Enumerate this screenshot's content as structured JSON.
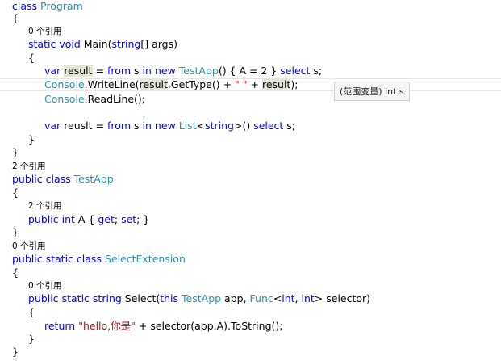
{
  "editor": {
    "lines": [
      {
        "kind": "code",
        "indent": 0,
        "tokens": [
          {
            "t": "class",
            "c": "kw"
          },
          {
            "t": " ",
            "c": "plain"
          },
          {
            "t": "Program",
            "c": "type"
          }
        ]
      },
      {
        "kind": "code",
        "indent": 0,
        "tokens": [
          {
            "t": "{",
            "c": "plain"
          }
        ]
      },
      {
        "kind": "codelens",
        "indent": 1,
        "tokens": [
          {
            "t": "0 个引用",
            "c": "plain"
          }
        ]
      },
      {
        "kind": "code",
        "indent": 1,
        "tokens": [
          {
            "t": "static",
            "c": "kw"
          },
          {
            "t": " ",
            "c": "plain"
          },
          {
            "t": "void",
            "c": "kw"
          },
          {
            "t": " Main(",
            "c": "plain"
          },
          {
            "t": "string",
            "c": "kw"
          },
          {
            "t": "[] args)",
            "c": "plain"
          }
        ]
      },
      {
        "kind": "code",
        "indent": 1,
        "tokens": [
          {
            "t": "{",
            "c": "plain"
          }
        ]
      },
      {
        "kind": "code",
        "indent": 2,
        "tokens": [
          {
            "t": "var",
            "c": "kw"
          },
          {
            "t": " ",
            "c": "plain"
          },
          {
            "t": "result",
            "c": "hl"
          },
          {
            "t": " = ",
            "c": "plain"
          },
          {
            "t": "from",
            "c": "kw"
          },
          {
            "t": " s ",
            "c": "plain"
          },
          {
            "t": "in",
            "c": "kw"
          },
          {
            "t": " ",
            "c": "plain"
          },
          {
            "t": "new",
            "c": "kw"
          },
          {
            "t": " ",
            "c": "plain"
          },
          {
            "t": "TestApp",
            "c": "type"
          },
          {
            "t": "() { A = 2 } ",
            "c": "plain"
          },
          {
            "t": "select",
            "c": "kw"
          },
          {
            "t": " s;",
            "c": "plain"
          }
        ]
      },
      {
        "kind": "code",
        "indent": 2,
        "tokens": [
          {
            "t": "Console",
            "c": "type"
          },
          {
            "t": ".WriteLine(",
            "c": "plain"
          },
          {
            "t": "result",
            "c": "hl"
          },
          {
            "t": ".GetType() + ",
            "c": "plain"
          },
          {
            "t": "\" \"",
            "c": "str"
          },
          {
            "t": " + ",
            "c": "plain"
          },
          {
            "t": "result",
            "c": "hl"
          },
          {
            "t": ");",
            "c": "plain"
          }
        ]
      },
      {
        "kind": "code",
        "indent": 2,
        "tokens": [
          {
            "t": "Console",
            "c": "type"
          },
          {
            "t": ".ReadLine();",
            "c": "plain"
          }
        ]
      },
      {
        "kind": "blank",
        "indent": 0,
        "tokens": []
      },
      {
        "kind": "code",
        "indent": 2,
        "tokens": [
          {
            "t": "var",
            "c": "kw"
          },
          {
            "t": " reuslt = ",
            "c": "plain"
          },
          {
            "t": "from",
            "c": "kw"
          },
          {
            "t": " s ",
            "c": "plain"
          },
          {
            "t": "in",
            "c": "kw"
          },
          {
            "t": " ",
            "c": "plain"
          },
          {
            "t": "new",
            "c": "kw"
          },
          {
            "t": " ",
            "c": "plain"
          },
          {
            "t": "List",
            "c": "type"
          },
          {
            "t": "<",
            "c": "plain"
          },
          {
            "t": "string",
            "c": "kw"
          },
          {
            "t": ">() ",
            "c": "plain"
          },
          {
            "t": "select",
            "c": "kw"
          },
          {
            "t": " s;",
            "c": "plain"
          }
        ]
      },
      {
        "kind": "code",
        "indent": 1,
        "tokens": [
          {
            "t": "}",
            "c": "plain"
          }
        ]
      },
      {
        "kind": "code",
        "indent": 0,
        "tokens": [
          {
            "t": "}",
            "c": "plain"
          }
        ]
      },
      {
        "kind": "codelens",
        "indent": 0,
        "tokens": [
          {
            "t": "2 个引用",
            "c": "plain"
          }
        ]
      },
      {
        "kind": "code",
        "indent": 0,
        "tokens": [
          {
            "t": "public",
            "c": "kw"
          },
          {
            "t": " ",
            "c": "plain"
          },
          {
            "t": "class",
            "c": "kw"
          },
          {
            "t": " ",
            "c": "plain"
          },
          {
            "t": "TestApp",
            "c": "type"
          }
        ]
      },
      {
        "kind": "code",
        "indent": 0,
        "tokens": [
          {
            "t": "{",
            "c": "plain"
          }
        ]
      },
      {
        "kind": "codelens",
        "indent": 1,
        "tokens": [
          {
            "t": "2 个引用",
            "c": "plain"
          }
        ]
      },
      {
        "kind": "code",
        "indent": 1,
        "tokens": [
          {
            "t": "public",
            "c": "kw"
          },
          {
            "t": " ",
            "c": "plain"
          },
          {
            "t": "int",
            "c": "kw"
          },
          {
            "t": " A { ",
            "c": "plain"
          },
          {
            "t": "get",
            "c": "kw"
          },
          {
            "t": "; ",
            "c": "plain"
          },
          {
            "t": "set",
            "c": "kw"
          },
          {
            "t": "; }",
            "c": "plain"
          }
        ]
      },
      {
        "kind": "code",
        "indent": 0,
        "tokens": [
          {
            "t": "}",
            "c": "plain"
          }
        ]
      },
      {
        "kind": "codelens",
        "indent": 0,
        "tokens": [
          {
            "t": "0 个引用",
            "c": "plain"
          }
        ]
      },
      {
        "kind": "code",
        "indent": 0,
        "tokens": [
          {
            "t": "public",
            "c": "kw"
          },
          {
            "t": " ",
            "c": "plain"
          },
          {
            "t": "static",
            "c": "kw"
          },
          {
            "t": " ",
            "c": "plain"
          },
          {
            "t": "class",
            "c": "kw"
          },
          {
            "t": " ",
            "c": "plain"
          },
          {
            "t": "SelectExtension",
            "c": "type"
          }
        ]
      },
      {
        "kind": "code",
        "indent": 0,
        "tokens": [
          {
            "t": "{",
            "c": "plain"
          }
        ]
      },
      {
        "kind": "codelens",
        "indent": 1,
        "tokens": [
          {
            "t": "0 个引用",
            "c": "plain"
          }
        ]
      },
      {
        "kind": "code",
        "indent": 1,
        "tokens": [
          {
            "t": "public",
            "c": "kw"
          },
          {
            "t": " ",
            "c": "plain"
          },
          {
            "t": "static",
            "c": "kw"
          },
          {
            "t": " ",
            "c": "plain"
          },
          {
            "t": "string",
            "c": "kw"
          },
          {
            "t": " Select(",
            "c": "plain"
          },
          {
            "t": "this",
            "c": "kw"
          },
          {
            "t": " ",
            "c": "plain"
          },
          {
            "t": "TestApp",
            "c": "type"
          },
          {
            "t": " app, ",
            "c": "plain"
          },
          {
            "t": "Func",
            "c": "type"
          },
          {
            "t": "<",
            "c": "plain"
          },
          {
            "t": "int",
            "c": "kw"
          },
          {
            "t": ", ",
            "c": "plain"
          },
          {
            "t": "int",
            "c": "kw"
          },
          {
            "t": "> selector)",
            "c": "plain"
          }
        ]
      },
      {
        "kind": "code",
        "indent": 1,
        "tokens": [
          {
            "t": "{",
            "c": "plain"
          }
        ]
      },
      {
        "kind": "code",
        "indent": 2,
        "tokens": [
          {
            "t": "return",
            "c": "kw"
          },
          {
            "t": " ",
            "c": "plain"
          },
          {
            "t": "\"hello,你是\"",
            "c": "str"
          },
          {
            "t": " + selector(app.A).ToString();",
            "c": "plain"
          }
        ]
      },
      {
        "kind": "code",
        "indent": 1,
        "tokens": [
          {
            "t": "}",
            "c": "plain"
          }
        ]
      },
      {
        "kind": "code",
        "indent": 0,
        "tokens": [
          {
            "t": "}",
            "c": "plain"
          }
        ]
      }
    ]
  },
  "tooltip": {
    "text": "(范围变量) int s"
  },
  "colors": {
    "keyword": "#0000ff",
    "type": "#2b91af",
    "string": "#a31515",
    "codelens": "#999999",
    "highlight_bg": "#e5e5d8"
  }
}
